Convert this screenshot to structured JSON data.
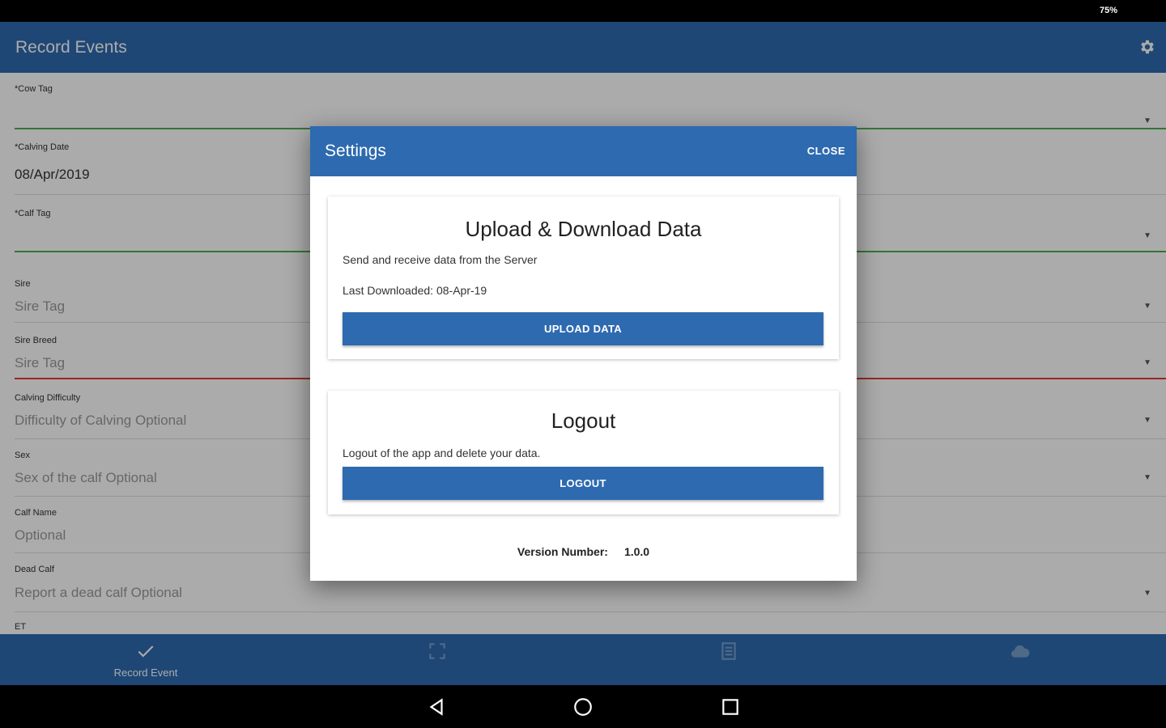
{
  "status_bar": {
    "battery": "75%"
  },
  "app_bar": {
    "title": "Record Events",
    "settings_icon": "gear-icon"
  },
  "form": {
    "fields": [
      {
        "label": "*Cow Tag",
        "value": "",
        "placeholder": ""
      },
      {
        "label": "*Calving Date",
        "value": "08/Apr/2019",
        "placeholder": ""
      },
      {
        "label": "*Calf Tag",
        "value": "",
        "placeholder": ""
      },
      {
        "label": "Sire",
        "value": "",
        "placeholder": "Sire Tag"
      },
      {
        "label": "Sire Breed",
        "value": "",
        "placeholder": "Sire Tag"
      },
      {
        "label": "Calving Difficulty",
        "value": "",
        "placeholder": "Difficulty of Calving Optional"
      },
      {
        "label": "Sex",
        "value": "",
        "placeholder": "Sex of the calf Optional"
      },
      {
        "label": "Calf Name",
        "value": "",
        "placeholder": "Optional"
      },
      {
        "label": "Dead Calf",
        "value": "",
        "placeholder": "Report a dead calf Optional"
      },
      {
        "label": "ET",
        "value": "",
        "placeholder": ""
      }
    ]
  },
  "bottom_nav": {
    "items": [
      {
        "label": "Record Event",
        "icon": "check-icon"
      },
      {
        "label": "",
        "icon": "scan-icon"
      },
      {
        "label": "",
        "icon": "list-icon"
      },
      {
        "label": "",
        "icon": "cloud-icon"
      }
    ]
  },
  "dialog": {
    "title": "Settings",
    "close_label": "CLOSE",
    "upload_card": {
      "title": "Upload & Download Data",
      "description": "Send and receive data from the Server",
      "last_downloaded": "Last Downloaded: 08-Apr-19",
      "button_label": "UPLOAD DATA"
    },
    "logout_card": {
      "title": "Logout",
      "description": "Logout of the app and delete your data.",
      "button_label": "LOGOUT"
    },
    "version_label": "Version Number:",
    "version_value": "1.0.0"
  },
  "colors": {
    "primary": "#2e6ab0",
    "valid_line": "#4caf50",
    "error_line": "#e53935"
  }
}
